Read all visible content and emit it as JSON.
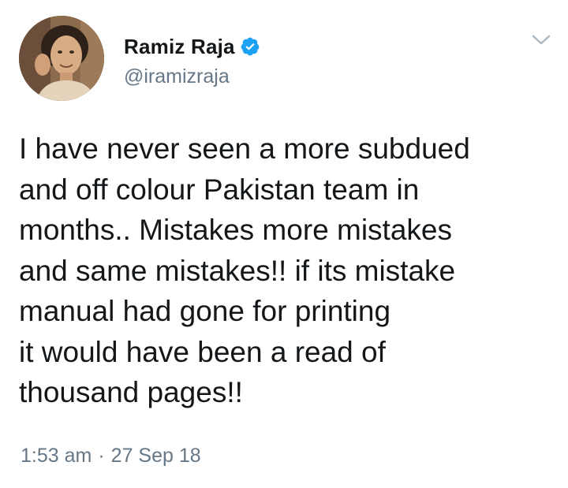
{
  "tweet": {
    "author": {
      "display_name": "Ramiz Raja",
      "handle": "@iramizraja",
      "verified": true,
      "avatar_icon": "profile-photo",
      "verified_icon": "verified-badge-icon"
    },
    "menu_icon": "chevron-down-icon",
    "text_lines": [
      "I have never seen a more subdued",
      "and off colour Pakistan team in",
      "months.. Mistakes more mistakes",
      "and same mistakes!! if its mistake",
      "manual had gone for printing",
      "it would have been a read of",
      "thousand pages!!"
    ],
    "time": "1:53 am",
    "separator": "·",
    "date": "27 Sep 18"
  },
  "colors": {
    "text": "#14171a",
    "secondary": "#657786",
    "verified_blue": "#1da1f2",
    "chevron": "#aab8c2"
  }
}
